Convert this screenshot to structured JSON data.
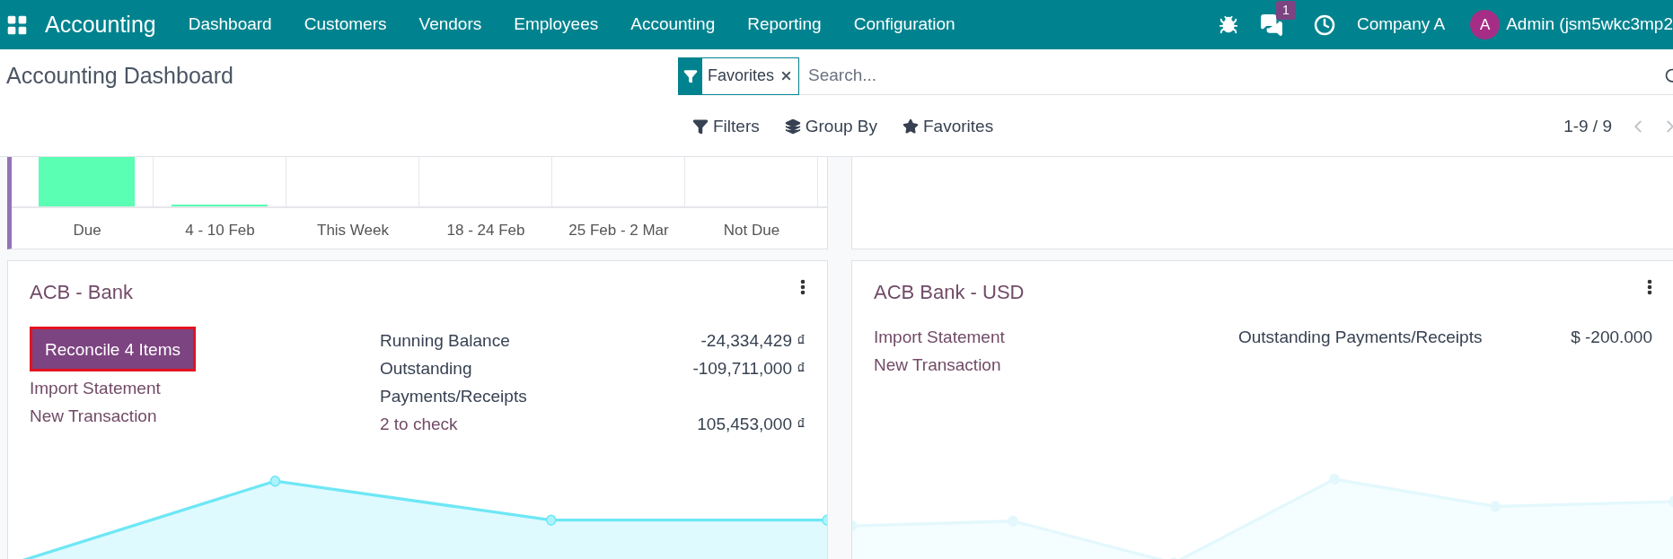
{
  "navbar": {
    "app_name": "Accounting",
    "menu": [
      "Dashboard",
      "Customers",
      "Vendors",
      "Employees",
      "Accounting",
      "Reporting",
      "Configuration"
    ],
    "messages_badge": "1",
    "company": "Company A",
    "avatar_letter": "A",
    "user": "Admin (jsm5wkc3mp2"
  },
  "control_panel": {
    "title": "Accounting Dashboard",
    "facet": {
      "label": "Favorites"
    },
    "search": {
      "placeholder": "Search..."
    },
    "buttons": [
      "Filters",
      "Group By",
      "Favorites"
    ],
    "pager": "1-9 / 9"
  },
  "aging_chart": {
    "labels": [
      "Due",
      "4 - 10 Feb",
      "This Week",
      "18 - 24 Feb",
      "25 Feb - 2 Mar",
      "Not Due"
    ]
  },
  "journals": [
    {
      "title": "ACB - Bank",
      "button": {
        "label": "Reconcile 4 Items",
        "highlighted": true
      },
      "links": [
        "Import Statement",
        "New Transaction"
      ],
      "stats": [
        {
          "label": "Running Balance",
          "value": "-24,334,429 ₫",
          "kind": "plain"
        },
        {
          "label": "Outstanding Payments/Receipts",
          "value": "-109,711,000 ₫",
          "kind": "plain"
        },
        {
          "label": "2 to check",
          "value": "105,453,000 ₫",
          "kind": "link"
        }
      ],
      "graph_faded": false
    },
    {
      "title": "ACB Bank - USD",
      "links": [
        "Import Statement",
        "New Transaction"
      ],
      "stats": [
        {
          "label": "Outstanding Payments/Receipts",
          "value": "$ -200.000",
          "kind": "plain"
        }
      ],
      "graph_faded": true
    }
  ]
}
